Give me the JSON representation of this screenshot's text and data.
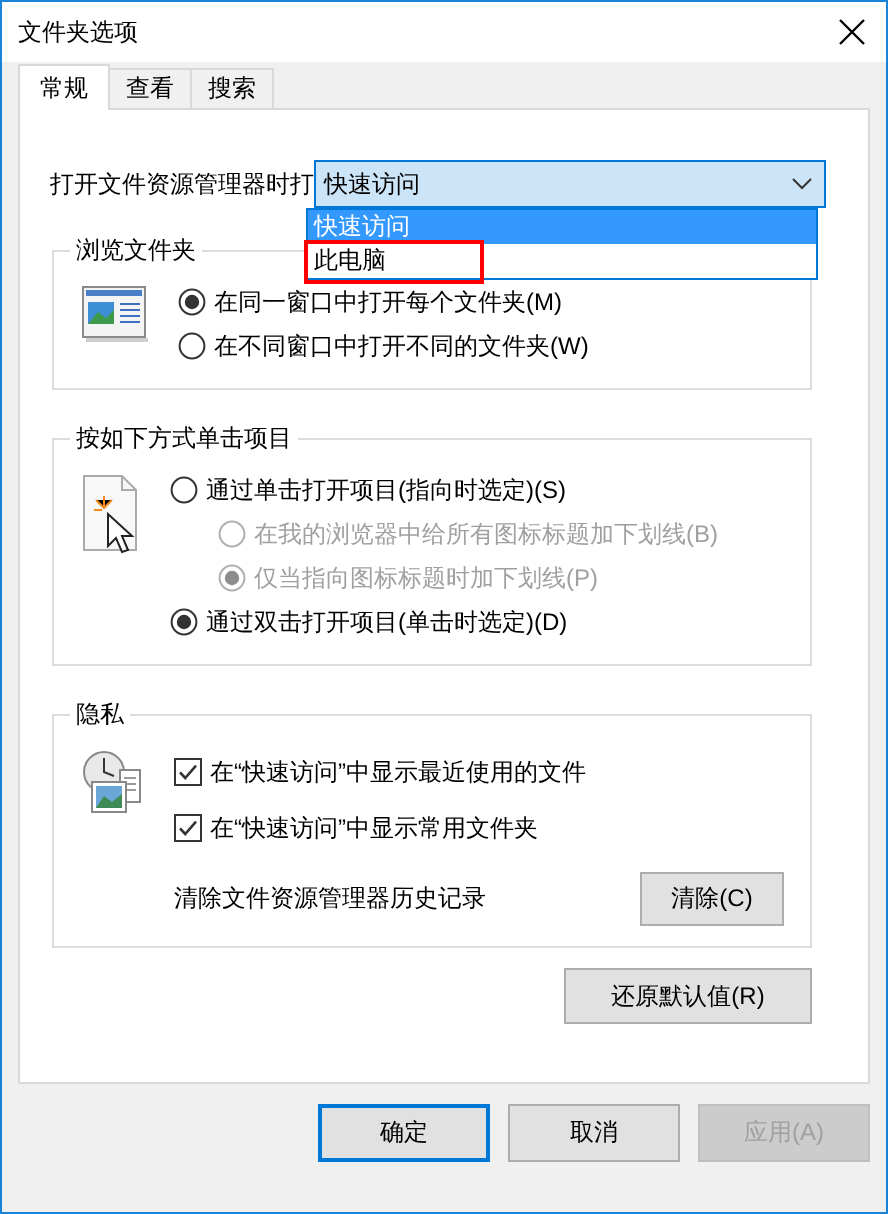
{
  "window": {
    "title": "文件夹选项"
  },
  "tabs": [
    {
      "label": "常规",
      "selected": true
    },
    {
      "label": "查看",
      "selected": false
    },
    {
      "label": "搜索",
      "selected": false
    }
  ],
  "open_in": {
    "label": "打开文件资源管理器时打",
    "value": "快速访问",
    "expanded": true,
    "options": [
      {
        "label": "快速访问",
        "selected": true,
        "highlighted": false
      },
      {
        "label": "此电脑",
        "selected": false,
        "highlighted": true
      }
    ]
  },
  "browse_folders": {
    "title": "浏览文件夹",
    "options": [
      {
        "label": "在同一窗口中打开每个文件夹(M)",
        "selected": true,
        "disabled": false
      },
      {
        "label": "在不同窗口中打开不同的文件夹(W)",
        "selected": false,
        "disabled": false
      }
    ]
  },
  "click_items": {
    "title": "按如下方式单击项目",
    "options": [
      {
        "label": "通过单击打开项目(指向时选定)(S)",
        "selected": false,
        "disabled": false,
        "children": [
          {
            "label": "在我的浏览器中给所有图标标题加下划线(B)",
            "selected": false,
            "disabled": true
          },
          {
            "label": "仅当指向图标标题时加下划线(P)",
            "selected": true,
            "disabled": true
          }
        ]
      },
      {
        "label": "通过双击打开项目(单击时选定)(D)",
        "selected": true,
        "disabled": false
      }
    ]
  },
  "privacy": {
    "title": "隐私",
    "checks": [
      {
        "label": "在“快速访问”中显示最近使用的文件",
        "checked": true
      },
      {
        "label": "在“快速访问”中显示常用文件夹",
        "checked": true
      }
    ],
    "clear_label": "清除文件资源管理器历史记录",
    "clear_button": "清除(C)"
  },
  "restore_button": "还原默认值(R)",
  "buttons": [
    {
      "label": "确定",
      "default": true,
      "disabled": false
    },
    {
      "label": "取消",
      "default": false,
      "disabled": false
    },
    {
      "label": "应用(A)",
      "default": false,
      "disabled": true
    }
  ]
}
